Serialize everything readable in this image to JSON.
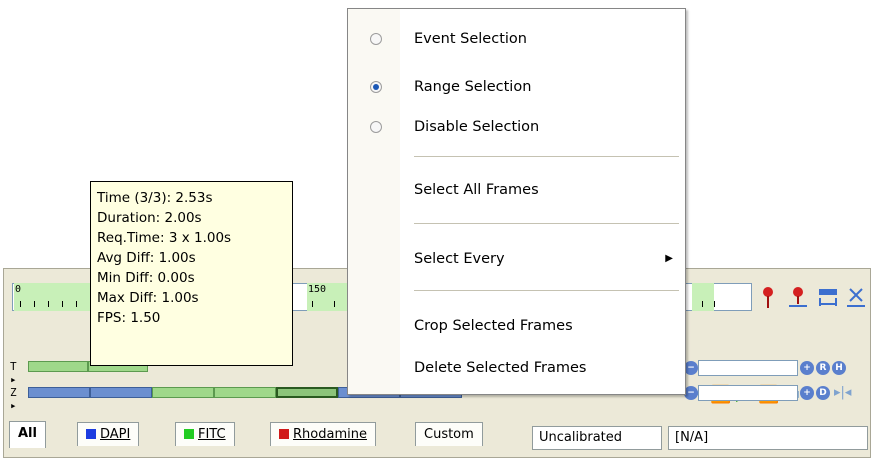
{
  "tooltip": {
    "lines": [
      "Time (3/3): 2.53s",
      "Duration: 2.00s",
      "Req.Time: 3 x 1.00s",
      "Avg Diff: 1.00s",
      "Min Diff: 0.00s",
      "Max Diff: 1.00s",
      "FPS: 1.50"
    ]
  },
  "menu": {
    "event_selection": "Event Selection",
    "range_selection": "Range Selection",
    "disable_selection": "Disable Selection",
    "selected_mode": "Range Selection",
    "select_all": "Select All Frames",
    "select_every": "Select Every",
    "crop": "Crop Selected Frames",
    "delete": "Delete Selected Frames"
  },
  "ruler": {
    "start_label": "0",
    "mid_label": "150"
  },
  "rows": {
    "t_label": "T ▸",
    "z_label": "Z ▸"
  },
  "tabs": [
    {
      "label": "All"
    },
    {
      "label": "DAPI",
      "color": "#1c3ce0"
    },
    {
      "label": "FITC",
      "color": "#22cc22"
    },
    {
      "label": "Rhodamine",
      "color": "#d11a1a"
    },
    {
      "label": "Custom"
    }
  ],
  "status": {
    "calibration": "Uncalibrated",
    "value": "[N/A]"
  },
  "colors": {
    "panel": "#ece9d8",
    "tooltip": "#ffffe1",
    "accent": "#5a7fcd"
  }
}
